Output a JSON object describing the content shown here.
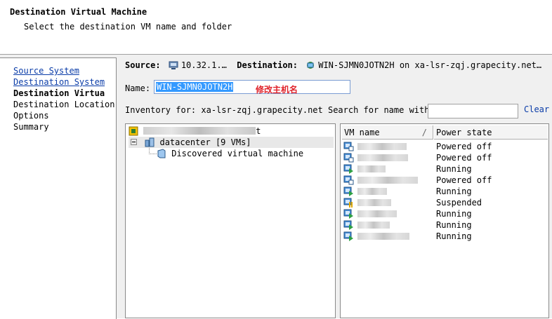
{
  "header": {
    "title": "Destination Virtual Machine",
    "subtitle": "Select the destination VM name and folder"
  },
  "nav": {
    "items": [
      {
        "label": "Source System",
        "state": "link"
      },
      {
        "label": "Destination System",
        "state": "link"
      },
      {
        "label": "Destination Virtua",
        "state": "current"
      },
      {
        "label": "Destination Location",
        "state": "plain"
      },
      {
        "label": "Options",
        "state": "plain"
      },
      {
        "label": "Summary",
        "state": "plain"
      }
    ]
  },
  "source_row": {
    "source_label": "Source:",
    "source_value": "10.32.1.…",
    "destination_label": "Destination:",
    "destination_value": "WIN-SJMN0JOTN2H on xa-lsr-zqj.grapecity.net…"
  },
  "name": {
    "label": "Name:",
    "value": "WIN-SJMN0JOTN2H",
    "annotation": "修改主机名"
  },
  "inventory": {
    "label": "Inventory for: xa-lsr-zqj.grapecity.net Search for name with:",
    "search_value": "",
    "clear_label": "Clear"
  },
  "tree": {
    "root_suffix": "t",
    "datacenter_label": "datacenter [9 VMs]",
    "folder_label": "Discovered virtual machine"
  },
  "vm_table": {
    "columns": [
      "VM name",
      "Power state"
    ],
    "sort_indicator": "/",
    "rows": [
      {
        "state": "Powered off",
        "icon": "vm-off-icon",
        "blur_width": 70
      },
      {
        "state": "Powered off",
        "icon": "vm-off-icon",
        "blur_width": 72
      },
      {
        "state": "Running",
        "icon": "vm-running-icon",
        "blur_width": 40
      },
      {
        "state": "Powered off",
        "icon": "vm-off-icon",
        "blur_width": 86
      },
      {
        "state": "Running",
        "icon": "vm-running-icon",
        "blur_width": 42
      },
      {
        "state": "Suspended",
        "icon": "vm-suspended-icon",
        "blur_width": 48
      },
      {
        "state": "Running",
        "icon": "vm-running-icon",
        "blur_width": 56
      },
      {
        "state": "Running",
        "icon": "vm-running-icon",
        "blur_width": 46
      },
      {
        "state": "Running",
        "icon": "vm-running-icon",
        "blur_width": 74
      }
    ]
  },
  "colors": {
    "link": "#0a3ca8",
    "selection": "#3399ff",
    "annotation": "#e0242b",
    "running": "#2ea043",
    "suspended": "#e0a800",
    "vm_body": "#4a90d9"
  }
}
